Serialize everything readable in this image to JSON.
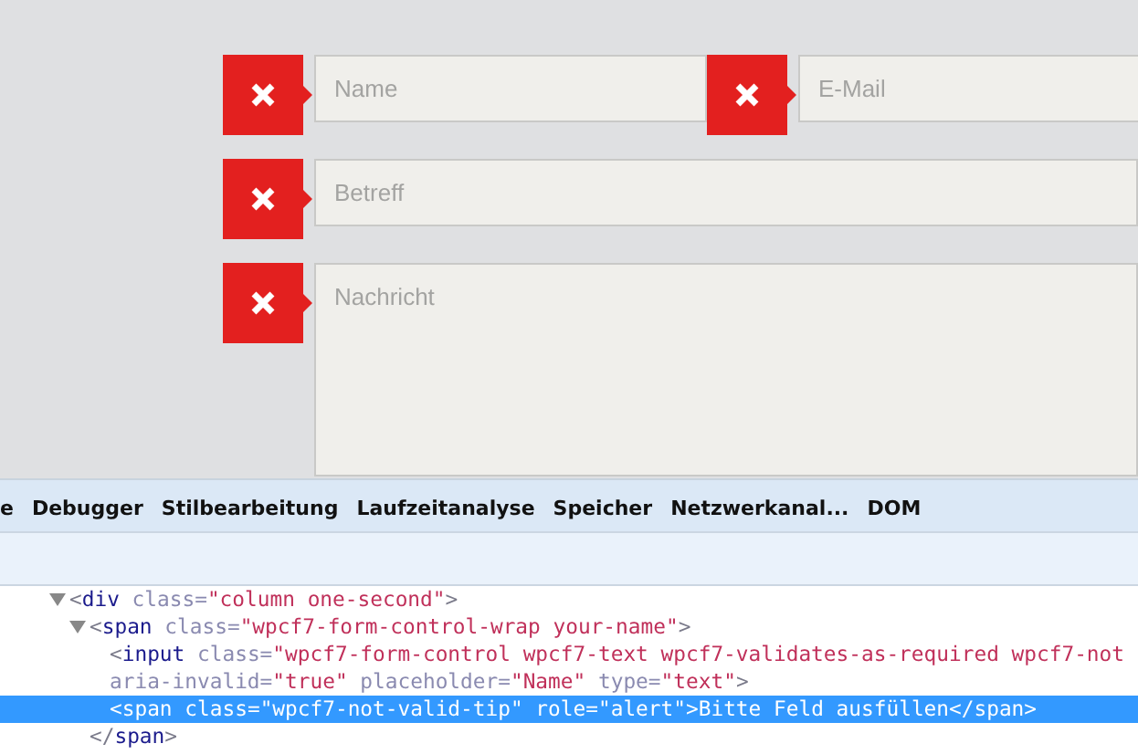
{
  "form": {
    "rows": [
      {
        "fields": [
          {
            "kind": "input",
            "placeholder": "Name",
            "invalid": true
          },
          {
            "kind": "input",
            "placeholder": "E-Mail",
            "invalid": true
          }
        ]
      },
      {
        "fields": [
          {
            "kind": "input",
            "placeholder": "Betreff",
            "invalid": true
          }
        ]
      },
      {
        "fields": [
          {
            "kind": "textarea",
            "placeholder": "Nachricht",
            "invalid": true
          }
        ]
      }
    ]
  },
  "devtools": {
    "tabs": [
      {
        "label": "e",
        "selected": false
      },
      {
        "label": "Debugger",
        "selected": false
      },
      {
        "label": "Stilbearbeitung",
        "selected": false
      },
      {
        "label": "Laufzeitanalyse",
        "selected": false
      },
      {
        "label": "Speicher",
        "selected": false
      },
      {
        "label": "Netzwerkanal...",
        "selected": false
      },
      {
        "label": "DOM",
        "selected": false
      }
    ],
    "tree": [
      {
        "expanded": true,
        "selected": false,
        "lines": [
          [
            {
              "kind": "p",
              "t": "<"
            },
            {
              "kind": "tag",
              "t": "div"
            },
            {
              "kind": "attr",
              "t": " class="
            },
            {
              "kind": "val",
              "t": "\"column one-second\""
            },
            {
              "kind": "p",
              "t": ">"
            }
          ]
        ],
        "children": [
          {
            "expanded": true,
            "selected": false,
            "lines": [
              [
                {
                  "kind": "p",
                  "t": "<"
                },
                {
                  "kind": "tag",
                  "t": "span"
                },
                {
                  "kind": "attr",
                  "t": " class="
                },
                {
                  "kind": "val",
                  "t": "\"wpcf7-form-control-wrap your-name\""
                },
                {
                  "kind": "p",
                  "t": ">"
                }
              ]
            ],
            "close": [
              {
                "kind": "p",
                "t": "</"
              },
              {
                "kind": "tag",
                "t": "span"
              },
              {
                "kind": "p",
                "t": ">"
              }
            ],
            "children": [
              {
                "selected": false,
                "lines": [
                  [
                    {
                      "kind": "p",
                      "t": "<"
                    },
                    {
                      "kind": "tag",
                      "t": "input"
                    },
                    {
                      "kind": "attr",
                      "t": " class="
                    },
                    {
                      "kind": "val",
                      "t": "\"wpcf7-form-control wpcf7-text wpcf7-validates-as-required wpcf7-not"
                    }
                  ],
                  [
                    {
                      "kind": "attr",
                      "t": "aria-invalid="
                    },
                    {
                      "kind": "val",
                      "t": "\"true\""
                    },
                    {
                      "kind": "attr",
                      "t": " placeholder="
                    },
                    {
                      "kind": "val",
                      "t": "\"Name\""
                    },
                    {
                      "kind": "attr",
                      "t": " type="
                    },
                    {
                      "kind": "val",
                      "t": "\"text\""
                    },
                    {
                      "kind": "p",
                      "t": ">"
                    }
                  ]
                ]
              },
              {
                "selected": true,
                "lines": [
                  [
                    {
                      "kind": "p",
                      "t": "<"
                    },
                    {
                      "kind": "tag",
                      "t": "span"
                    },
                    {
                      "kind": "attr",
                      "t": " class="
                    },
                    {
                      "kind": "val",
                      "t": "\"wpcf7-not-valid-tip\""
                    },
                    {
                      "kind": "attr",
                      "t": " role="
                    },
                    {
                      "kind": "val",
                      "t": "\"alert\""
                    },
                    {
                      "kind": "p",
                      "t": ">"
                    },
                    {
                      "kind": "text",
                      "t": "Bitte Feld ausfüllen"
                    },
                    {
                      "kind": "p",
                      "t": "</"
                    },
                    {
                      "kind": "tag",
                      "t": "span"
                    },
                    {
                      "kind": "p",
                      "t": ">"
                    }
                  ]
                ]
              }
            ]
          }
        ]
      }
    ]
  }
}
